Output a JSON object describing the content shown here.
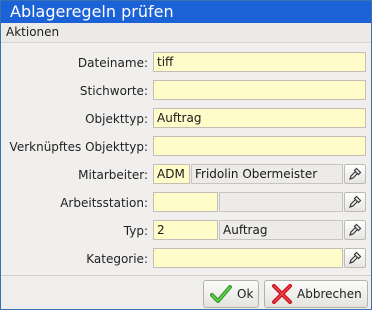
{
  "window": {
    "title": "Ablageregeln prüfen"
  },
  "menubar": {
    "items": [
      {
        "label": "Aktionen"
      }
    ]
  },
  "form": {
    "dateiname": {
      "label": "Dateiname:",
      "value": "tiff"
    },
    "stichworte": {
      "label": "Stichworte:",
      "value": ""
    },
    "objekttyp": {
      "label": "Objekttyp:",
      "value": "Auftrag"
    },
    "verknuepftes_objekttyp": {
      "label": "Verknüpftes Objekttyp:",
      "value": ""
    },
    "mitarbeiter": {
      "label": "Mitarbeiter:",
      "code": "ADM",
      "name": "Fridolin Obermeister"
    },
    "arbeitsstation": {
      "label": "Arbeitsstation:",
      "code": "",
      "name": ""
    },
    "typ": {
      "label": "Typ:",
      "code": "2",
      "name": "Auftrag"
    },
    "kategorie": {
      "label": "Kategorie:",
      "value": ""
    }
  },
  "buttons": {
    "ok": "Ok",
    "cancel": "Abbrechen"
  },
  "icons": {
    "picker": "picker-icon",
    "ok": "check-icon",
    "cancel": "cross-icon"
  },
  "colors": {
    "titlebar": "#1b62d6",
    "field_bg": "#fffcc9",
    "ok_green": "#3cab2c",
    "cancel_red": "#d8121c"
  }
}
